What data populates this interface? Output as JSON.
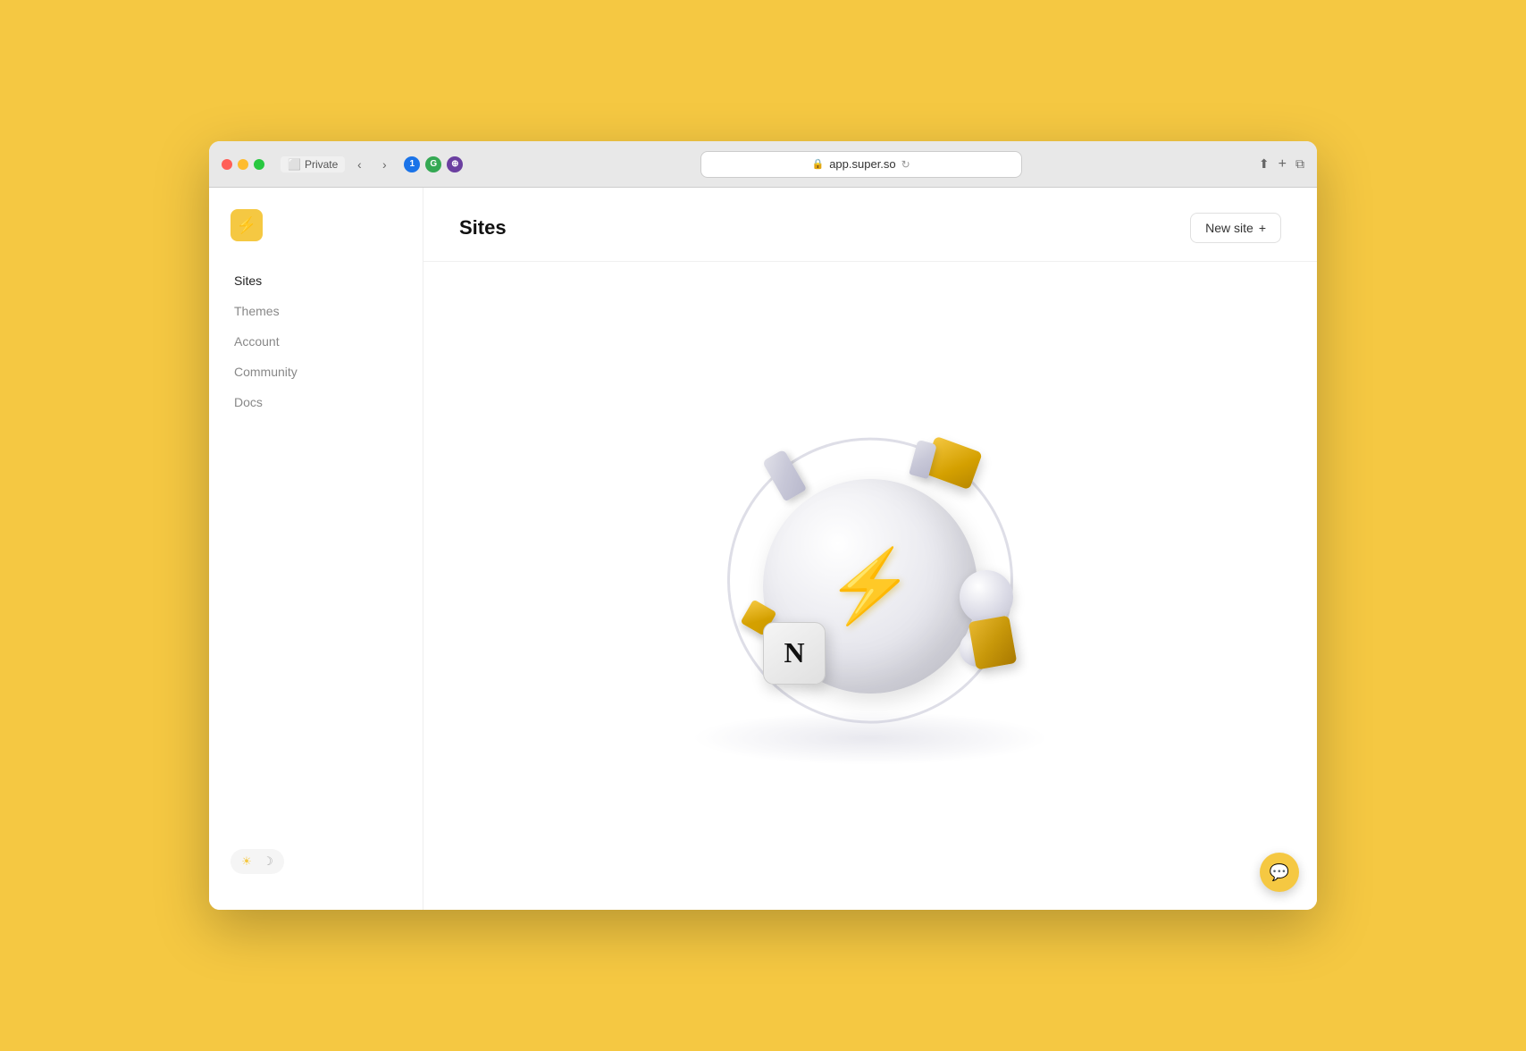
{
  "browser": {
    "url": "app.super.so",
    "private_label": "Private",
    "tab_number": "1"
  },
  "sidebar": {
    "logo_icon": "⚡",
    "items": [
      {
        "id": "sites",
        "label": "Sites",
        "active": true
      },
      {
        "id": "themes",
        "label": "Themes",
        "active": false
      },
      {
        "id": "account",
        "label": "Account",
        "active": false
      },
      {
        "id": "community",
        "label": "Community",
        "active": false
      },
      {
        "id": "docs",
        "label": "Docs",
        "active": false
      }
    ],
    "theme_toggle": {
      "sun_icon": "☀",
      "moon_icon": "☽"
    }
  },
  "main": {
    "page_title": "Sites",
    "new_site_button": "New site",
    "new_site_plus": "+"
  },
  "illustration": {
    "notion_letter": "N",
    "lightning": "⚡"
  },
  "chat": {
    "icon": "💬"
  }
}
